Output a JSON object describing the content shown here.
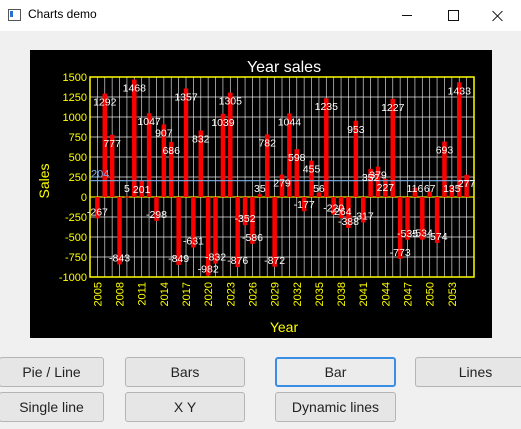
{
  "window": {
    "title": "Charts demo"
  },
  "buttons": {
    "pie_line": "Pie / Line",
    "bars": "Bars",
    "bar": "Bar",
    "lines": "Lines",
    "single_line": "Single line",
    "xy": "X Y",
    "dynamic_lines": "Dynamic lines"
  },
  "colors": {
    "background": "#000000",
    "axis": "#ffff00",
    "grid": "#ffffff",
    "bars": "#ff0000",
    "average": "#7ab0e8",
    "labels": "#ffffff"
  },
  "chart_data": {
    "type": "bar",
    "title": "Year sales",
    "xlabel": "Year",
    "ylabel": "Sales",
    "ylim": [
      -1000,
      1500
    ],
    "yticks": [
      1500,
      1250,
      1000,
      750,
      500,
      250,
      0,
      -250,
      -500,
      -750,
      -1000
    ],
    "xticks": [
      "2005",
      "2008",
      "2011",
      "2014",
      "2017",
      "2020",
      "2023",
      "2026",
      "2029",
      "2032",
      "2035",
      "2038",
      "2041",
      "2044",
      "2047",
      "2050",
      "2053"
    ],
    "grid": true,
    "average_label": "204",
    "x": [
      2005,
      2006,
      2007,
      2008,
      2009,
      2010,
      2011,
      2012,
      2013,
      2014,
      2015,
      2016,
      2017,
      2018,
      2019,
      2020,
      2021,
      2022,
      2023,
      2024,
      2025,
      2026,
      2027,
      2028,
      2029,
      2030,
      2031,
      2032,
      2033,
      2034,
      2035,
      2036,
      2037,
      2038,
      2039,
      2040,
      2041,
      2042,
      2043,
      2044,
      2045,
      2046,
      2047,
      2048,
      2049,
      2050,
      2051,
      2052,
      2053,
      2054,
      2055
    ],
    "values": [
      -267,
      1292,
      777,
      -843,
      5,
      1468,
      201,
      1047,
      -298,
      907,
      686,
      -849,
      1357,
      -631,
      832,
      -982,
      -832,
      1039,
      1305,
      -876,
      -352,
      -586,
      35,
      782,
      -872,
      279,
      1044,
      598,
      -177,
      455,
      56,
      1235,
      -220,
      -264,
      -388,
      953,
      -317,
      352,
      379,
      227,
      1227,
      -773,
      -535,
      116,
      -534,
      67,
      -574,
      693,
      135,
      1433,
      277
    ],
    "data_labels": [
      "-267",
      "1292",
      "777",
      "-843",
      "5",
      "1468",
      "201",
      "1047",
      "-298",
      "907",
      "686",
      "-849",
      "1357",
      "-631",
      "832",
      "-982",
      "-832",
      "1039",
      "1305",
      "-876",
      "-352",
      "-586",
      "35",
      "782",
      "-872",
      "279",
      "1044",
      "598",
      "-177",
      "455",
      "56",
      "1235",
      "-220",
      "-264",
      "-388",
      "953",
      "-317",
      "352",
      "379",
      "227",
      "1227",
      "-773",
      "-535",
      "116",
      "-534",
      "67",
      "-574",
      "693",
      "135",
      "1433",
      "277"
    ]
  }
}
